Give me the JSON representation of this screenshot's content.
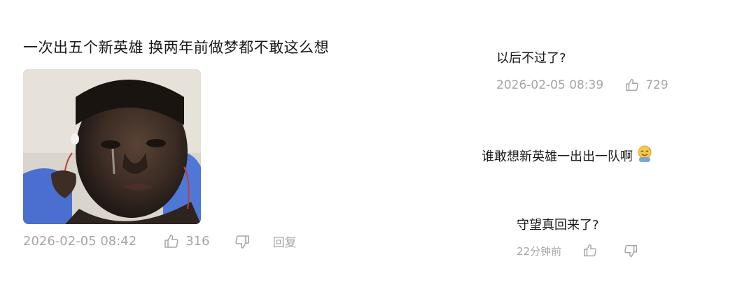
{
  "main_post": {
    "text": "一次出五个新英雄 换两年前做梦都不敢这么想",
    "image_alt": "crying man meme photo",
    "timestamp": "2026-02-05 08:42",
    "likes": "316",
    "reply_label": "回复",
    "like_icon": "thumbs-up-icon",
    "dislike_icon": "thumbs-down-icon"
  },
  "comments": [
    {
      "text": "以后不过了?",
      "timestamp": "2026-02-05 08:39",
      "likes": "729"
    },
    {
      "text": "谁敢想新英雄一出出一队啊",
      "emoji": "sweating-smile-emoji"
    },
    {
      "text": "守望真回来了?",
      "timestamp": "22分钟前"
    }
  ],
  "colors": {
    "text": "#1a1a1a",
    "meta": "#a6a6a6",
    "background": "#ffffff"
  }
}
